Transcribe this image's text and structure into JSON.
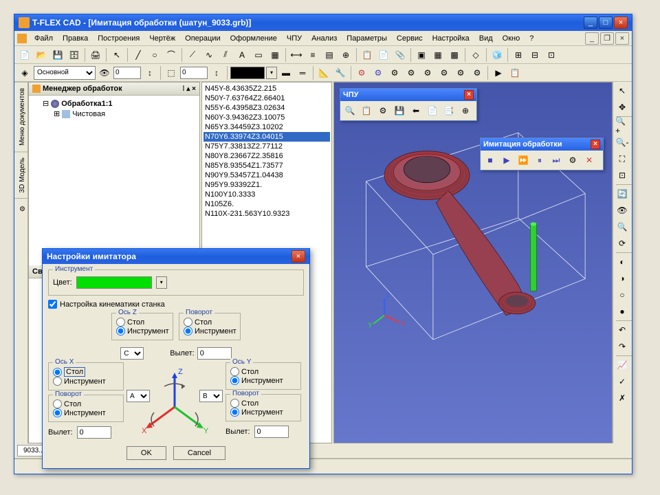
{
  "window": {
    "title": "T-FLEX CAD - [Имитация обработки (шатун_9033.grb)]"
  },
  "menu": {
    "items": [
      "Файл",
      "Правка",
      "Построения",
      "Чертёж",
      "Операции",
      "Оформление",
      "ЧПУ",
      "Анализ",
      "Параметры",
      "Сервис",
      "Настройка",
      "Вид",
      "Окно",
      "?"
    ]
  },
  "toolbar2": {
    "layer_label": "Основной",
    "value1": "0",
    "value2": "0",
    "value3": "0"
  },
  "leftpanel": {
    "header": "Менеджер обработок",
    "tree": {
      "root": "Обработка1:1",
      "child": "Чистовая"
    },
    "props_header": "Свойства"
  },
  "sidebar_tabs": [
    "Меню документов",
    "3D Модель"
  ],
  "gcode": {
    "lines": [
      "N45Y-8.43635Z2.215",
      "N50Y-7.63764Z2.66401",
      "N55Y-6.43958Z3.02634",
      "N60Y-3.94362Z3.10075",
      "N65Y3.34459Z3.10202",
      "N70Y6.33974Z3.04015",
      "N75Y7.33813Z2.77112",
      "N80Y8.23667Z2.35816",
      "N85Y8.93554Z1.73577",
      "N90Y9.53457Z1.04438",
      "N95Y9.93392Z1.",
      "N100Y10.3333",
      "N105Z6.",
      "N110X-231.563Y10.9323"
    ],
    "selected_index": 5
  },
  "floating": {
    "cnc_title": "ЧПУ",
    "sim_title": "Имитация обработки"
  },
  "dialog": {
    "title": "Настройки имитатора",
    "group_instrument": "Инструмент",
    "color_label": "Цвет:",
    "check_kinematics": "Настройка кинематики станка",
    "axis_z": "Ось Z",
    "axis_x": "Ось X",
    "axis_y": "Ось Y",
    "rotation": "Поворот",
    "option_stol": "Стол",
    "option_instrument": "Инструмент",
    "vylet": "Вылет:",
    "vylet_value": "0",
    "dropdown_a": "A",
    "dropdown_b": "B",
    "dropdown_c": "C",
    "ok": "OK",
    "cancel": "Cancel"
  },
  "viewport": {
    "axes": {
      "x": "x",
      "y": "y",
      "z": "z"
    }
  },
  "taskbar_doc": "9033..."
}
